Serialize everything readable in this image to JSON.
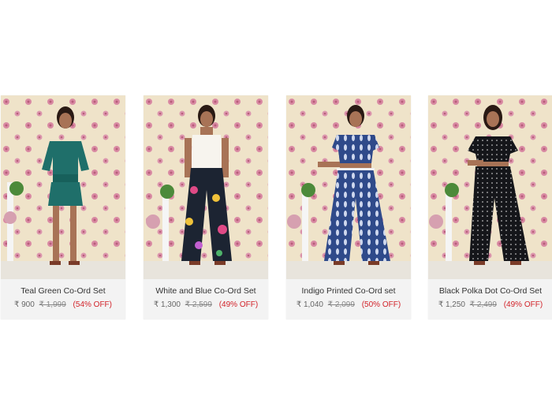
{
  "currency_symbol": "₹",
  "products": [
    {
      "name": "Teal Green Co-Ord Set",
      "price": "₹ 900",
      "mrp": "₹ 1,999",
      "discount": "(54% OFF)",
      "image": "model-teal-green-coord-image",
      "outfit_color": "#1f6f6a"
    },
    {
      "name": "White and Blue Co-Ord Set",
      "price": "₹ 1,300",
      "mrp": "₹ 2,599",
      "discount": "(49% OFF)",
      "image": "model-white-blue-floral-coord-image",
      "outfit_color": "#1c2432"
    },
    {
      "name": "Indigo Printed Co-Ord set",
      "price": "₹ 1,040",
      "mrp": "₹ 2,099",
      "discount": "(50% OFF)",
      "image": "model-indigo-printed-coord-image",
      "outfit_color": "#2f4a8a"
    },
    {
      "name": "Black Polka Dot Co-Ord Set",
      "price": "₹ 1,250",
      "mrp": "₹ 2,499",
      "discount": "(49% OFF)",
      "image": "model-black-polka-dot-coord-image",
      "outfit_color": "#15161a"
    }
  ],
  "colors": {
    "discount": "#d2232a",
    "card_bg": "#f3f3f3",
    "wallpaper": "#efe3c9",
    "wallpaper_flower": "#d98aa3"
  }
}
